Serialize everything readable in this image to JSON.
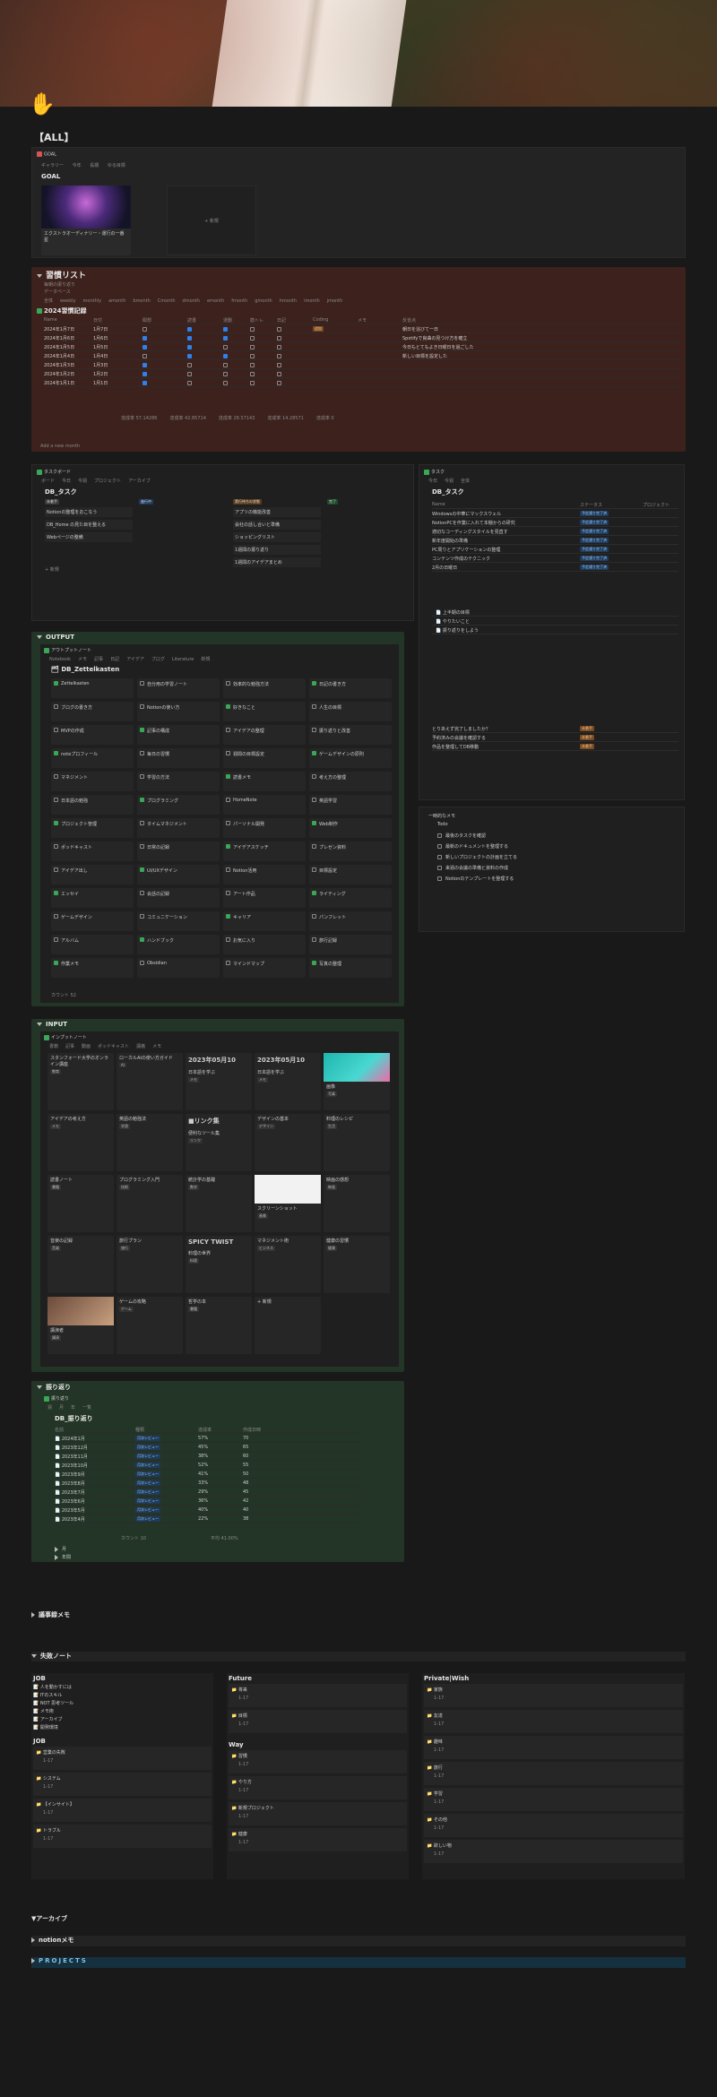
{
  "page": {
    "title": "【ALL】",
    "icon": "raised-hand-icon"
  },
  "goal": {
    "crumb": "GOAL",
    "tabs": [
      "ギャラリー",
      "今年",
      "長期",
      "ゆる目標"
    ],
    "heading": "GOAL",
    "card_caption": "エクストラオーディナリー・運行の一番星",
    "new_label": "+ 新規"
  },
  "habit": {
    "title": "習慣リスト",
    "sub1": "毎朝の振り返り",
    "sub2": "データベース",
    "tabs": [
      "全体",
      "weekly",
      "monthly",
      "amonth",
      "bmonth",
      "Cmonth",
      "dmonth",
      "emonth",
      "fmonth",
      "gmonth",
      "hmonth",
      "imonth",
      "jmonth"
    ],
    "db_title": "2024習慣記録",
    "columns": [
      "Name",
      "日付",
      "瞑想",
      "読書",
      "運動",
      "筋トレ",
      "日記",
      "Coding",
      "メモ",
      "反省点"
    ],
    "rows": [
      {
        "name": "2024年1月7日",
        "date": "1月7日",
        "c": [
          0,
          1,
          1,
          0,
          0
        ],
        "tag": "追加",
        "note": "朝日を浴びて一日"
      },
      {
        "name": "2024年1月6日",
        "date": "1月6日",
        "c": [
          1,
          1,
          1,
          0,
          0
        ],
        "tag": "",
        "note": "Spotifyで良曲の見つけ方を確立"
      },
      {
        "name": "2024年1月5日",
        "date": "1月5日",
        "c": [
          1,
          1,
          0,
          0,
          0
        ],
        "tag": "",
        "note": "今日もとてもよき日曜日を過ごした"
      },
      {
        "name": "2024年1月4日",
        "date": "1月4日",
        "c": [
          0,
          1,
          1,
          0,
          0
        ],
        "tag": "",
        "note": "新しい目標を設定した"
      },
      {
        "name": "2024年1月3日",
        "date": "1月3日",
        "c": [
          1,
          0,
          0,
          0,
          0
        ],
        "tag": "",
        "note": ""
      },
      {
        "name": "2024年1月2日",
        "date": "1月2日",
        "c": [
          1,
          0,
          0,
          0,
          0
        ],
        "tag": "",
        "note": ""
      },
      {
        "name": "2024年1月1日",
        "date": "1月1日",
        "c": [
          1,
          0,
          0,
          0,
          0
        ],
        "tag": "",
        "note": ""
      }
    ],
    "stats": [
      "達成率 57.14286",
      "達成率 42.85714",
      "達成率 28.57143",
      "達成率 14.28571",
      "達成率 0"
    ],
    "footer": "Add a new month"
  },
  "tasks_left": {
    "crumb": "タスクボード",
    "tabs": [
      "ボード",
      "今日",
      "今週",
      "プロジェクト",
      "アーカイブ"
    ],
    "title": "DB_タスク",
    "groups": [
      {
        "label": "未着手",
        "color": "#3a3a3a",
        "cards": [
          "Notionの整理をおこなう",
          "DB_Home の見た目を整える",
          "Webページの整備"
        ]
      },
      {
        "label": "進行中",
        "color": "#1e3a5c",
        "cards": []
      },
      {
        "label": "実行待ちの状態",
        "color": "#5a3a1a",
        "cards": [
          "アプリの機能改善",
          "会社の話し合いと準備",
          "ショッピングリスト",
          "1週間の振り返り",
          "1週間のアイデアまとめ"
        ]
      },
      {
        "label": "完了",
        "color": "#1e4a2c",
        "cards": []
      }
    ],
    "new_label": "+ 新規"
  },
  "tasks_right": {
    "crumb": "タスク",
    "tabs": [
      "今日",
      "今週",
      "全体"
    ],
    "title": "DB_タスク",
    "col_name": "Name",
    "col_status": "ステータス",
    "col_project": "プロジェクト",
    "items": [
      {
        "name": "Windowsの中華にマックスウェル",
        "status": "予定通り完了済"
      },
      {
        "name": "NotionPCを作業に入れて本棚からの研究",
        "status": "予定通り完了済"
      },
      {
        "name": "適切なコーディングスタイルを見直す",
        "status": "予定通り完了済"
      },
      {
        "name": "新年度開始の準備",
        "status": "予定通り完了済"
      },
      {
        "name": "PC周りとアプリケーションの整理",
        "status": "予定通り完了済"
      },
      {
        "name": "コンテンツ作成のテクニック",
        "status": "予定通り完了済"
      },
      {
        "name": "2月の日曜日",
        "status": "予定通り完了済"
      }
    ],
    "items2": [
      "上半期の目標",
      "やりたいこと",
      "振り返りをしよう"
    ],
    "items3": [
      {
        "name": "とりあえず完了しましたか？",
        "status": "未着手"
      },
      {
        "name": "予約済みの会議を確認する",
        "status": "未着手"
      },
      {
        "name": "作品を整理してDB移動",
        "status": "未着手"
      }
    ]
  },
  "todo_right": {
    "title": "一時的なメモ",
    "sub": "Todo",
    "items": [
      "最後のタスクを確認",
      "最新のドキュメントを整理する",
      "新しいプロジェクトの計画を立てる",
      "来週の会議の準備と資料の作成",
      "Notionのテンプレートを整理する"
    ]
  },
  "output": {
    "title": "OUTPUT",
    "sub": "アウトプットノート",
    "tabs": [
      "Notebook",
      "メモ",
      "記事",
      "日記",
      "アイデア",
      "ブログ",
      "Literature",
      "新規"
    ],
    "db_title": "DB_Zettelkasten",
    "cards": [
      "Zettelkasten",
      "自分用の学習ノート",
      "効率的な勉強方法",
      "日記の書き方",
      "ブログの書き方",
      "Notionの使い方",
      "好きなこと",
      "人生の目標",
      "MVPの作成",
      "記事の構成",
      "アイデアの整理",
      "振り返りと改善",
      "noteプロフィール",
      "毎日の習慣",
      "週間の目標設定",
      "ゲームデザインの原則",
      "マネジメント",
      "学習の方法",
      "読書メモ",
      "考え方の整理",
      "日本語の勉強",
      "プログラミング",
      "HomeNote",
      "英語学習",
      "プロジェクト管理",
      "タイムマネジメント",
      "パーソナル開発",
      "Web制作",
      "ポッドキャスト",
      "日常の記録",
      "アイデアスケッチ",
      "プレゼン資料",
      "アイデア出し",
      "UI/UXデザイン",
      "Notion活用",
      "目標設定",
      "エッセイ",
      "会話の記録",
      "アート作品",
      "ライティング",
      "ゲームデザイン",
      "コミュニケーション",
      "キャリア",
      "パンフレット",
      "アルバム",
      "ハンドブック",
      "お気に入り",
      "旅行記録",
      "作業メモ",
      "Obsidian",
      "マインドマップ",
      "写真の整理"
    ],
    "new_label": "+ 新規",
    "count": "カウント 52"
  },
  "input": {
    "title": "INPUT",
    "sub": "インプットノート",
    "tabs": [
      "書籍",
      "記事",
      "動画",
      "ポッドキャスト",
      "講義",
      "メモ"
    ],
    "cards": [
      {
        "title": "",
        "body": "スタンフォード大学のオンライン講座",
        "tag": "教育"
      },
      {
        "title": "",
        "body": "ローカルAIの使い方ガイド",
        "tag": "AI"
      },
      {
        "title": "2023年05月10",
        "body": "日本語を学ぶ",
        "tag": "メモ"
      },
      {
        "title": "2023年05月10",
        "body": "日本語を学ぶ",
        "tag": "メモ"
      },
      {
        "title": "",
        "body": "画像",
        "tag": "写真"
      },
      {
        "title": "",
        "body": "アイデアの考え方",
        "tag": "メモ"
      },
      {
        "title": "",
        "body": "英語の勉強法",
        "tag": "学習"
      },
      {
        "title": "■リンク集",
        "body": "便利なツール集",
        "tag": "リンク"
      },
      {
        "title": "",
        "body": "デザインの基本",
        "tag": "デザイン"
      },
      {
        "title": "",
        "body": "料理のレシピ",
        "tag": "生活"
      },
      {
        "title": "",
        "body": "読書ノート",
        "tag": "書籍"
      },
      {
        "title": "",
        "body": "プログラミング入門",
        "tag": "技術"
      },
      {
        "title": "",
        "body": "統計学の基礎",
        "tag": "数学"
      },
      {
        "title": "",
        "body": "スクリーンショット",
        "tag": "画像"
      },
      {
        "title": "",
        "body": "映画の感想",
        "tag": "映画"
      },
      {
        "title": "",
        "body": "音楽の記録",
        "tag": "音楽"
      },
      {
        "title": "",
        "body": "旅行プラン",
        "tag": "旅行"
      },
      {
        "title": "SPICY TWIST",
        "body": "料理の世界",
        "tag": "料理"
      },
      {
        "title": "",
        "body": "マネジメント術",
        "tag": "ビジネス"
      },
      {
        "title": "",
        "body": "健康の習慣",
        "tag": "健康"
      },
      {
        "title": "",
        "body": "講演者",
        "tag": "講演"
      },
      {
        "title": "",
        "body": "ゲームの攻略",
        "tag": "ゲーム"
      },
      {
        "title": "",
        "body": "哲学の本",
        "tag": "書籍"
      },
      {
        "title": "",
        "body": "+ 新規",
        "tag": ""
      }
    ]
  },
  "review": {
    "title": "振り返り",
    "sub": "振り返り",
    "tabs": [
      "週",
      "月",
      "年",
      "一覧"
    ],
    "db_title": "DB_振り返り",
    "columns": [
      "名前",
      "種類",
      "達成率",
      "作成日時"
    ],
    "rows": [
      {
        "name": "2024年1月",
        "kind": "月次レビュー",
        "rate": "57%",
        "val": "70"
      },
      {
        "name": "2023年12月",
        "kind": "月次レビュー",
        "rate": "45%",
        "val": "65"
      },
      {
        "name": "2023年11月",
        "kind": "月次レビュー",
        "rate": "38%",
        "val": "60"
      },
      {
        "name": "2023年10月",
        "kind": "月次レビュー",
        "rate": "52%",
        "val": "55"
      },
      {
        "name": "2023年9月",
        "kind": "月次レビュー",
        "rate": "41%",
        "val": "50"
      },
      {
        "name": "2023年8月",
        "kind": "月次レビュー",
        "rate": "33%",
        "val": "48"
      },
      {
        "name": "2023年7月",
        "kind": "月次レビュー",
        "rate": "29%",
        "val": "45"
      },
      {
        "name": "2023年6月",
        "kind": "月次レビュー",
        "rate": "36%",
        "val": "42"
      },
      {
        "name": "2023年5月",
        "kind": "月次レビュー",
        "rate": "40%",
        "val": "40"
      },
      {
        "name": "2023年4月",
        "kind": "月次レビュー",
        "rate": "22%",
        "val": "38"
      }
    ],
    "footer_left": "カウント 10",
    "footer_right": "平均 41.00%",
    "links": [
      "月",
      "年間"
    ]
  },
  "meeting": {
    "title": "議事録メモ"
  },
  "failure": {
    "title": "失敗ノート",
    "col1_title": "JOB",
    "col1_items": [
      "人を動かすには",
      "ITのスキル",
      "NOT 思考ツール",
      "メモ術",
      "アーカイブ",
      "開発環境"
    ],
    "col1b_title": "JOB",
    "col1b_cards": [
      {
        "title": "営業の失敗",
        "sub": "1-17"
      },
      {
        "title": "システム",
        "sub": "1-17"
      },
      {
        "title": "【インサイト】",
        "sub": "1-17"
      },
      {
        "title": "トラブル",
        "sub": "1-17"
      }
    ],
    "col2_title": "Future",
    "col2_cards": [
      {
        "title": "将来",
        "sub": "1-17"
      },
      {
        "title": "目標",
        "sub": "1-17"
      }
    ],
    "col2b_title": "Way",
    "col2b_cards": [
      {
        "title": "習慣",
        "sub": "1-17"
      },
      {
        "title": "やり方",
        "sub": "1-17"
      },
      {
        "title": "新規プロジェクト",
        "sub": "1-17"
      },
      {
        "title": "健康",
        "sub": "1-17"
      }
    ],
    "col3_title": "Private|Wish",
    "col3_cards": [
      {
        "title": "家族",
        "sub": "1-17"
      },
      {
        "title": "友達",
        "sub": "1-17"
      },
      {
        "title": "趣味",
        "sub": "1-17"
      },
      {
        "title": "旅行",
        "sub": "1-17"
      },
      {
        "title": "学習",
        "sub": "1-17"
      },
      {
        "title": "その他",
        "sub": "1-17"
      },
      {
        "title": "欲しい物",
        "sub": "1-17"
      }
    ]
  },
  "archive": {
    "title": "▼アーカイブ"
  },
  "notion_memo": {
    "title": "notionメモ"
  },
  "projects": {
    "title": "PROJECTS"
  },
  "colors": {
    "habit_bg": "#3d211c",
    "output_bg": "#223526",
    "input_bg": "#223526",
    "review_bg": "#223526",
    "projects_bg": "#15303f",
    "accent_blue": "#2f80ed"
  }
}
